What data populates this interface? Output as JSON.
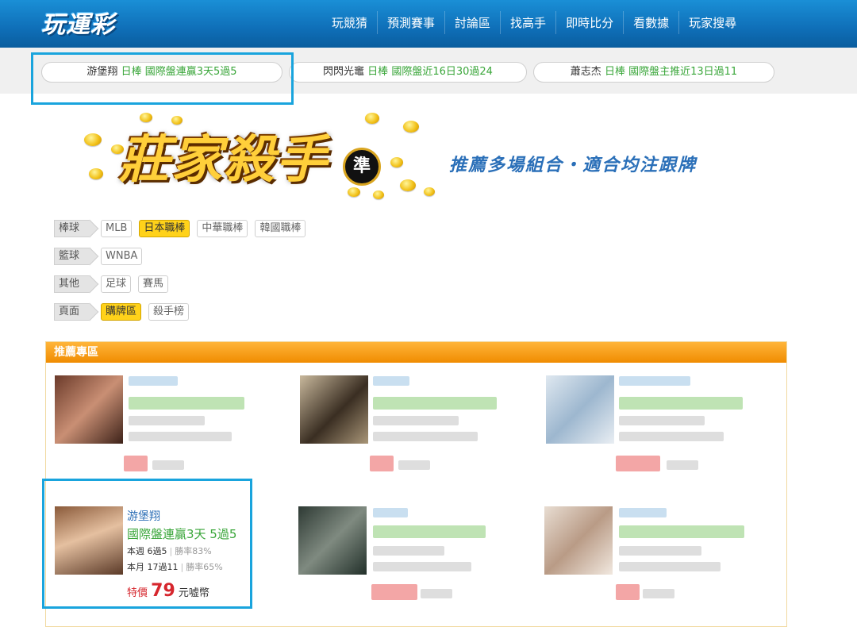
{
  "site": {
    "logo_text": "玩運彩"
  },
  "nav": [
    "玩競猜",
    "預測賽事",
    "討論區",
    "找高手",
    "即時比分",
    "看數據",
    "玩家搜尋"
  ],
  "ticker": [
    {
      "name": "游堡翔",
      "league": "日棒",
      "record": "國際盤連贏3天5過5"
    },
    {
      "name": "閃閃光竈",
      "league": "日棒",
      "record": "國際盤近16日30過24"
    },
    {
      "name": "蕭志杰",
      "league": "日棒",
      "record": "國際盤主推近13日過11"
    }
  ],
  "banner": {
    "title": "莊家殺手",
    "badge": "準",
    "subtitle": "推薦多場組合・適合均注跟牌"
  },
  "filters": [
    {
      "category": "棒球",
      "tags": [
        {
          "label": "MLB",
          "active": false
        },
        {
          "label": "日本職棒",
          "active": true
        },
        {
          "label": "中華職棒",
          "active": false
        },
        {
          "label": "韓國職棒",
          "active": false
        }
      ]
    },
    {
      "category": "籃球",
      "tags": [
        {
          "label": "WNBA",
          "active": false
        }
      ]
    },
    {
      "category": "其他",
      "tags": [
        {
          "label": "足球",
          "active": false
        },
        {
          "label": "賽馬",
          "active": false
        }
      ]
    },
    {
      "category": "頁面",
      "tags": [
        {
          "label": "購牌區",
          "active": true
        },
        {
          "label": "殺手榜",
          "active": false
        }
      ]
    }
  ],
  "recommend": {
    "heading": "推薦專區",
    "featured": {
      "name": "游堡翔",
      "record": "國際盤連贏3天 5過5",
      "week_label": "本週 6過5",
      "week_rate": "勝率83%",
      "month_label": "本月 17過11",
      "month_rate": "勝率65%",
      "price_prefix": "特價",
      "price": "79",
      "price_unit": "元嘘幣"
    }
  },
  "colors": {
    "nav_blue": "#0f6fb8",
    "accent_green": "#3aa63a",
    "price_red": "#d6262d",
    "tag_active": "#ffd21a",
    "highlight": "#19a4dd"
  }
}
